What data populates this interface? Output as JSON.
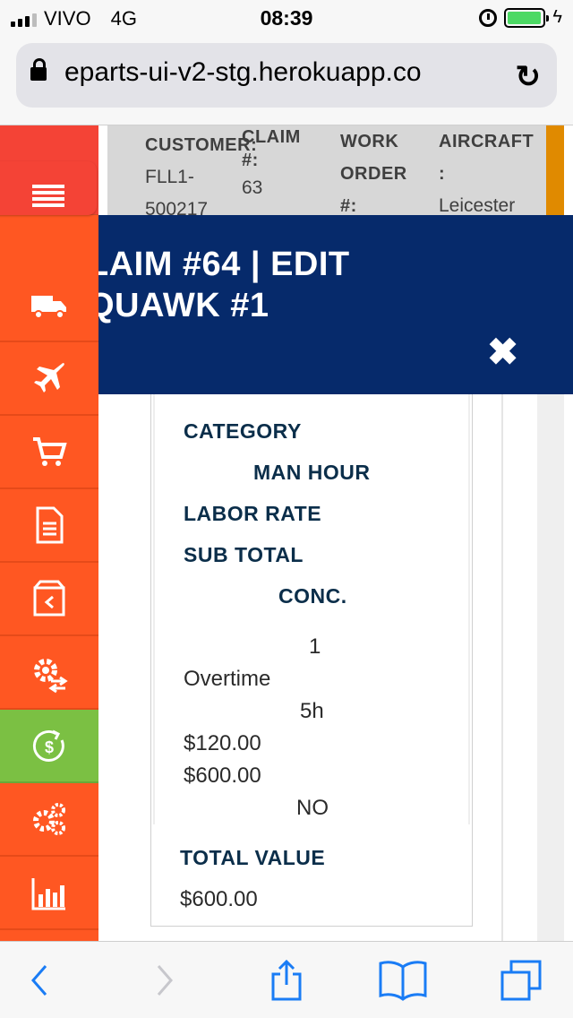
{
  "status_bar": {
    "carrier": "VIVO",
    "network": "4G",
    "time": "08:39",
    "battery_level": 0.95
  },
  "url_bar": {
    "url": "eparts-ui-v2-stg.herokuapp.co"
  },
  "background": {
    "columns": [
      {
        "header": "CUSTOMER:",
        "value_lines": [
          "FLL1-",
          "500217"
        ]
      },
      {
        "header": "CLAIM #:",
        "value_lines": [
          "63"
        ]
      },
      {
        "header": "WORK ORDER #:",
        "value_lines": []
      },
      {
        "header": "AIRCRAFT :",
        "value_lines": [
          "Leicester"
        ]
      }
    ]
  },
  "sidebar": {
    "items": [
      {
        "icon": "truck-icon"
      },
      {
        "icon": "airplane-icon"
      },
      {
        "icon": "cart-icon"
      },
      {
        "icon": "document-icon"
      },
      {
        "icon": "return-box-icon"
      },
      {
        "icon": "gear-exchange-icon"
      },
      {
        "icon": "money-refresh-icon",
        "active": true
      },
      {
        "icon": "gears-icon"
      },
      {
        "icon": "bar-chart-icon"
      }
    ],
    "active_color": "#7bc043",
    "color": "#ff5722"
  },
  "modal": {
    "title_line1": "LAIM #64 | EDIT",
    "title_line2": "QUAWK #1",
    "header_color": "#062a6b",
    "labels": {
      "category": "CATEGORY",
      "man_hour": "MAN HOUR",
      "labor_rate": "LABOR RATE",
      "sub_total": "SUB TOTAL",
      "conc": "CONC.",
      "total_value": "TOTAL VALUE"
    },
    "values": {
      "index": "1",
      "category": "Overtime",
      "man_hour": "5h",
      "labor_rate": "$120.00",
      "sub_total": "$600.00",
      "conc": "NO",
      "total_value": "$600.00"
    }
  },
  "toolbar": {
    "buttons": [
      "back",
      "forward",
      "share",
      "bookmarks",
      "tabs"
    ]
  }
}
